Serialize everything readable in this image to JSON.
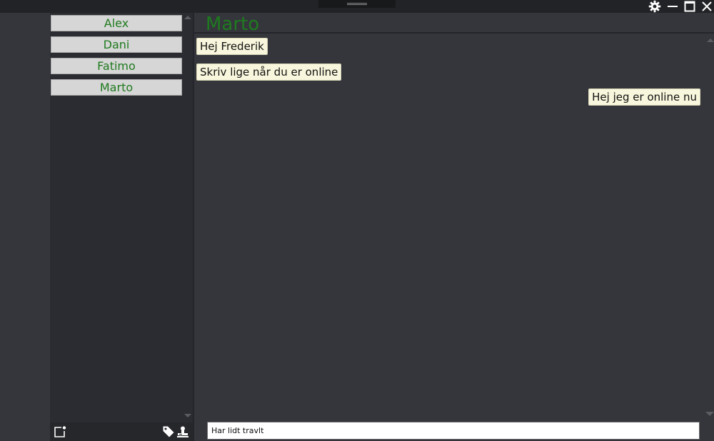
{
  "window": {
    "buttons": [
      {
        "icon": "gear-icon"
      },
      {
        "icon": "minimize-icon"
      },
      {
        "icon": "maximize-icon"
      },
      {
        "icon": "close-icon"
      }
    ]
  },
  "contacts": {
    "items": [
      {
        "label": "Alex"
      },
      {
        "label": "Dani"
      },
      {
        "label": "Fatimo"
      },
      {
        "label": "Marto"
      }
    ],
    "footer_icons": [
      "new-chat-icon",
      "tag-icon",
      "user-stamp-icon"
    ]
  },
  "chat": {
    "title": "Marto",
    "messages": [
      {
        "text": "Hej Frederik",
        "side": "left"
      },
      {
        "text": "Skriv lige når du er online",
        "side": "left"
      },
      {
        "text": "Hej jeg er online nu",
        "side": "right"
      }
    ],
    "input": {
      "value": "Har lidt travlt",
      "placeholder": ""
    }
  },
  "colors": {
    "accent_green": "#1f7a1f",
    "bubble_bg": "#f8f6dc",
    "background": "#34363c",
    "panel": "#2b2c31"
  }
}
